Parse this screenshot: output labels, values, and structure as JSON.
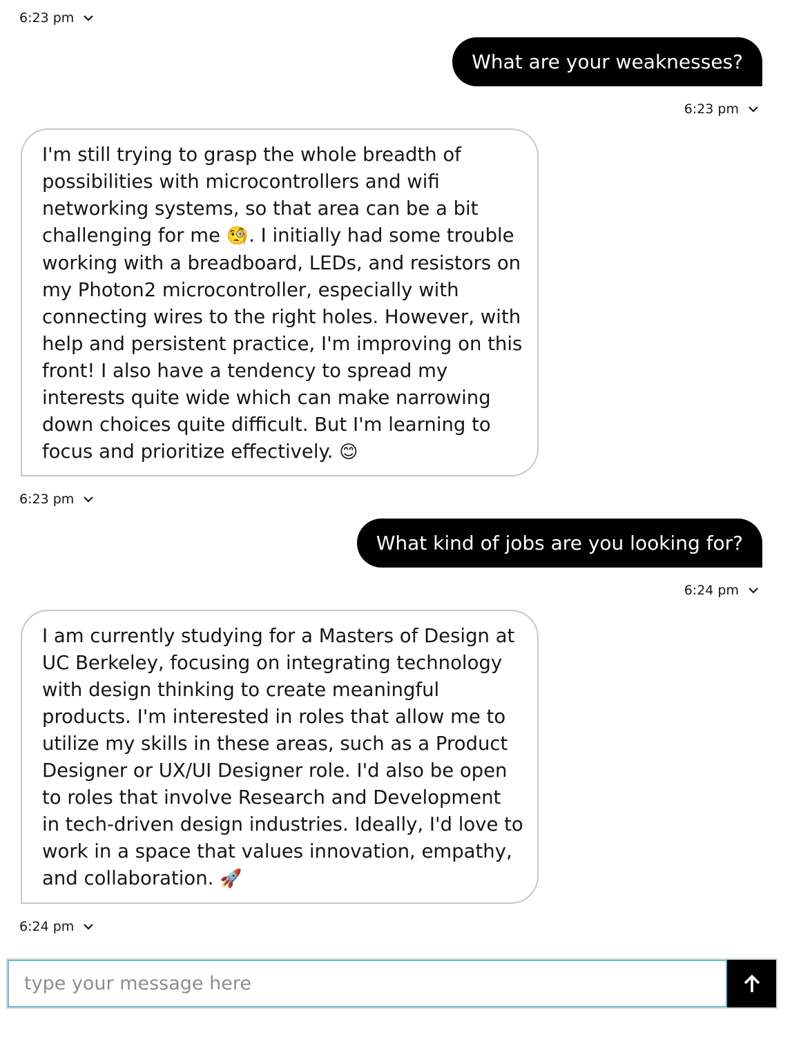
{
  "messages": [
    {
      "role": "bot_meta",
      "time": "6:23 pm"
    },
    {
      "role": "user",
      "text": "What are your weaknesses?",
      "time": "6:23 pm"
    },
    {
      "role": "bot",
      "text_before_emoji": "I'm still trying to grasp the whole breadth of possibilities with microcontrollers and wifi networking systems, so that area can be a bit challenging for me ",
      "emoji_1": "🧐",
      "text_after_emoji": ". I initially had some trouble working with a breadboard, LEDs, and resistors on my Photon2 microcontroller, especially with connecting wires to the right holes. However, with help and persistent practice, I'm improving on this front! I also have a tendency to spread my interests quite wide which can make narrowing down choices quite difficult. But I'm learning to focus and prioritize effectively. ",
      "emoji_2": "😊",
      "time": "6:23 pm"
    },
    {
      "role": "user",
      "text": "What kind of jobs are you looking for?",
      "time": "6:24 pm"
    },
    {
      "role": "bot",
      "text": "I am currently studying for a Masters of Design at UC Berkeley, focusing on integrating technology with design thinking to create meaningful products. I'm interested in roles that allow me to utilize my skills in these areas, such as a Product Designer or UX/UI Designer role. I'd also be open to roles that involve Research and Development in tech-driven design industries. Ideally, I'd love to work in a space that values innovation, empathy, and collaboration. ",
      "emoji": "🚀",
      "time": "6:24 pm"
    }
  ],
  "composer": {
    "placeholder": "type your message here",
    "value": "",
    "send_icon": "arrow-up-icon"
  },
  "colors": {
    "user_bubble": "#000000",
    "bot_border": "#c6c6c6",
    "input_focus_border": "#74b9d3"
  }
}
